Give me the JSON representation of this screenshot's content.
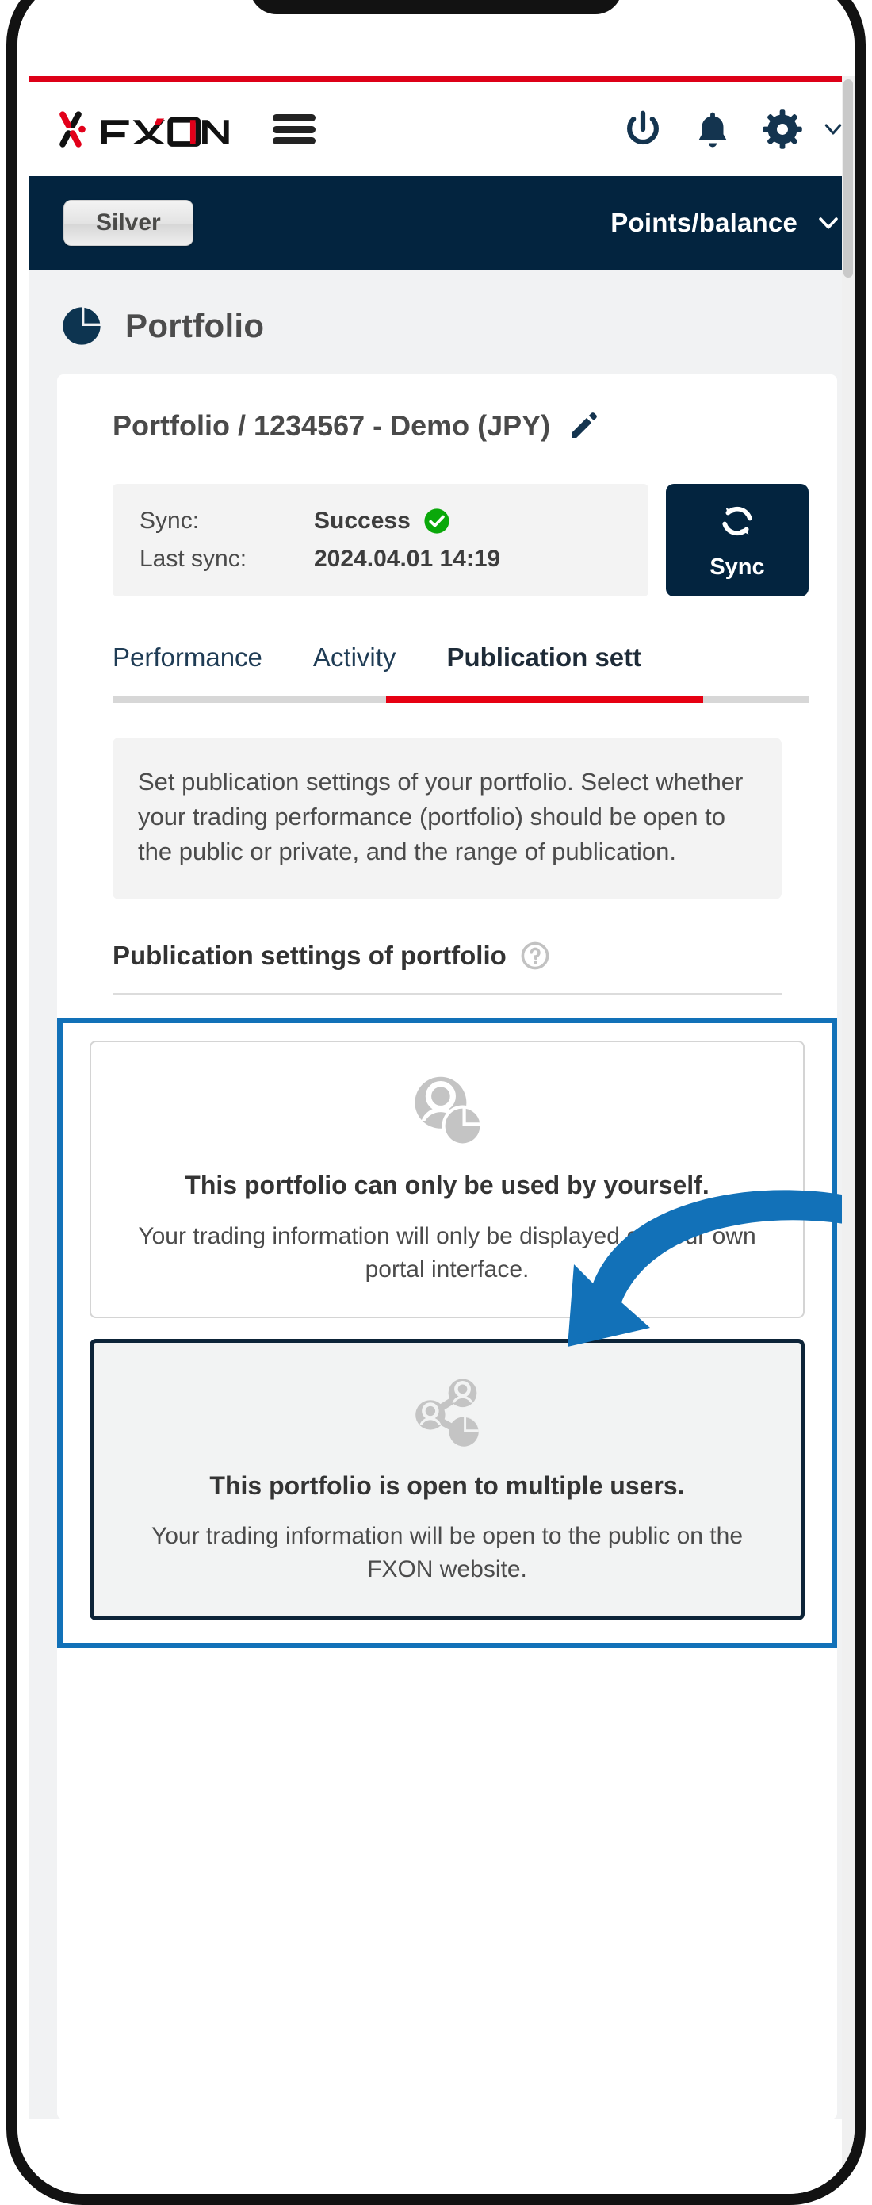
{
  "brand": {
    "name": "FXON",
    "accent_red": "#dd0018",
    "navy": "#03243f",
    "highlight_blue": "#1271b8"
  },
  "header": {
    "logo_text": "FXON",
    "menu_icon": "hamburger-icon",
    "icons": [
      "power-icon",
      "bell-icon",
      "gear-icon",
      "chevron-down-icon"
    ]
  },
  "subheader": {
    "rank_label": "Silver",
    "points_label": "Points/balance",
    "chevron": "chevron-down-icon"
  },
  "page": {
    "icon": "pie-chart-icon",
    "title": "Portfolio"
  },
  "card": {
    "title": "Portfolio / 1234567 - Demo (JPY)",
    "edit_icon": "pencil-icon",
    "sync": {
      "status_key": "Sync:",
      "status_value": "Success",
      "status_icon": "check-circle-icon",
      "last_key": "Last sync:",
      "last_value": "2024.04.01 14:19",
      "button_label": "Sync",
      "button_icon": "refresh-icon"
    },
    "tabs": [
      {
        "label": "Performance",
        "active": false
      },
      {
        "label": "Activity",
        "active": false
      },
      {
        "label": "Publication sett",
        "active": true
      }
    ],
    "description": "Set publication settings of your portfolio. Select whether your trading performance (portfolio) should be open to the public or private, and the range of publication.",
    "section": {
      "title": "Publication settings of portfolio",
      "help_icon": "help-circle-icon"
    },
    "options": [
      {
        "icon": "user-pie-icon",
        "title": "This portfolio can only be used by yourself.",
        "description": "Your trading information will only be displayed on your own portal interface.",
        "selected": false
      },
      {
        "icon": "share-network-icon",
        "title": "This portfolio is open to multiple users.",
        "description": "Your trading information will be open to the public on the FXON website.",
        "selected": true
      }
    ]
  },
  "annotation": {
    "arrow": "curved-arrow-icon",
    "color": "#1271b8"
  }
}
